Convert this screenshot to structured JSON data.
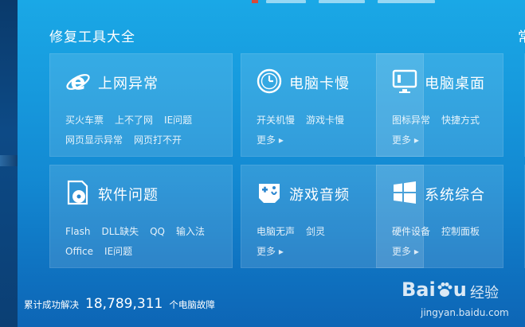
{
  "section_title": "修复工具大全",
  "section_title_partial": "常",
  "cards": [
    {
      "title": "上网异常",
      "icon": "ie-icon",
      "links": [
        "买火车票",
        "上不了网",
        "IE问题",
        "网页显示异常",
        "网页打不开"
      ],
      "more": ""
    },
    {
      "title": "电脑卡慢",
      "icon": "clock-icon",
      "links": [
        "开关机慢",
        "游戏卡慢"
      ],
      "more": "更多 ▸"
    },
    {
      "title": "电脑桌面",
      "icon": "monitor-icon",
      "links": [
        "图标异常",
        "快捷方式"
      ],
      "more": "更多 ▸"
    },
    {
      "title": "软件问题",
      "icon": "disc-icon",
      "links": [
        "Flash",
        "DLL缺失",
        "QQ",
        "输入法",
        "Office",
        "IE问题"
      ],
      "more": ""
    },
    {
      "title": "游戏音频",
      "icon": "gamepad-icon",
      "links": [
        "电脑无声",
        "剑灵"
      ],
      "more": "更多 ▸"
    },
    {
      "title": "系统综合",
      "icon": "windows-icon",
      "links": [
        "硬件设备",
        "控制面板"
      ],
      "more": "更多 ▸"
    }
  ],
  "footer": {
    "label": "累计成功解决",
    "count": "18,789,311",
    "suffix": "个电脑故障"
  },
  "watermark": {
    "logo_text": "Bai",
    "logo_text_2": "u",
    "jingyan": "经验",
    "url": "jingyan.baidu.com"
  }
}
